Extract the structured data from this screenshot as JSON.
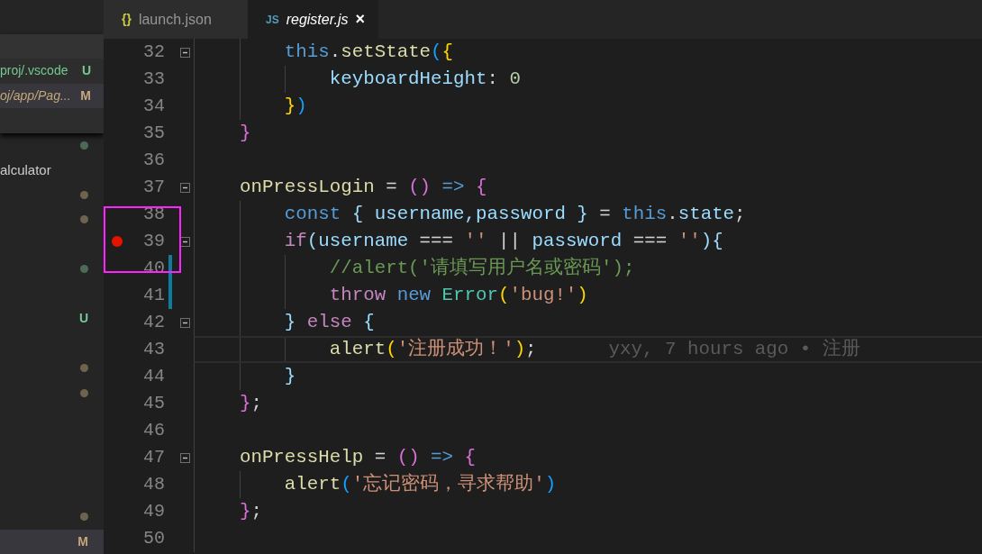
{
  "tabs": [
    {
      "label": "launch.json",
      "icon": "{}",
      "kind": "json",
      "selected": false
    },
    {
      "label": "register.js",
      "icon": "JS",
      "kind": "js",
      "selected": true,
      "close": "×"
    }
  ],
  "open_editors": [
    {
      "kind": "header"
    },
    {
      "kind": "file",
      "label": "proj/.vscode",
      "badge": "U",
      "color": "#73c991",
      "selected": false
    },
    {
      "kind": "file",
      "label": "oj/app/Pag...",
      "badge": "M",
      "color": "#c5a77a",
      "selected": true
    },
    {
      "kind": "blank"
    }
  ],
  "explorer": [
    {
      "kind": "dot",
      "color": "#4b6b55"
    },
    {
      "kind": "folder",
      "label": "alculator"
    },
    {
      "kind": "dot",
      "color": "#6f6350"
    },
    {
      "kind": "dot",
      "color": "#6f6350"
    },
    {
      "kind": "blank"
    },
    {
      "kind": "dot",
      "color": "#4b6b55"
    },
    {
      "kind": "blank"
    },
    {
      "kind": "badge",
      "badge": "U",
      "color": "#73c991",
      "selected": false
    },
    {
      "kind": "blank"
    },
    {
      "kind": "dot",
      "color": "#6f6350"
    },
    {
      "kind": "dot",
      "color": "#6f6350"
    },
    {
      "kind": "blank"
    },
    {
      "kind": "blank"
    },
    {
      "kind": "blank"
    },
    {
      "kind": "blank"
    },
    {
      "kind": "dot",
      "color": "#6f6350"
    },
    {
      "kind": "badge",
      "badge": "M",
      "color": "#c5a77a",
      "selected": true
    }
  ],
  "lines": [
    {
      "number": "32",
      "fold": true,
      "breakpoint": false,
      "changed": false,
      "tokens": [
        {
          "text": "        this",
          "kind": "keyword"
        },
        {
          "text": ".",
          "kind": "plain"
        },
        {
          "text": "setState",
          "kind": "function"
        },
        {
          "text": "(",
          "kind": "bracket",
          "color": "#179fff"
        },
        {
          "text": "{",
          "kind": "bracket",
          "color": "#ffd700"
        }
      ]
    },
    {
      "number": "33",
      "fold": false,
      "breakpoint": false,
      "changed": false,
      "tokens": [
        {
          "text": "            keyboardHeight",
          "kind": "property"
        },
        {
          "text": ": ",
          "kind": "plain"
        },
        {
          "text": "0",
          "kind": "number"
        }
      ]
    },
    {
      "number": "34",
      "fold": false,
      "breakpoint": false,
      "changed": false,
      "tokens": [
        {
          "text": "        }",
          "kind": "bracket",
          "color": "#ffd700"
        },
        {
          "text": ")",
          "kind": "bracket",
          "color": "#179fff"
        }
      ]
    },
    {
      "number": "35",
      "fold": false,
      "breakpoint": false,
      "changed": false,
      "tokens": [
        {
          "text": "    }",
          "kind": "bracket",
          "color": "#da70d6"
        }
      ]
    },
    {
      "number": "36",
      "fold": false,
      "breakpoint": false,
      "changed": false
    },
    {
      "number": "37",
      "fold": true,
      "breakpoint": false,
      "changed": false,
      "tokens": [
        {
          "text": "    onPressLogin",
          "kind": "function"
        },
        {
          "text": " = ",
          "kind": "plain"
        },
        {
          "text": "()",
          "kind": "bracket",
          "color": "#da70d6"
        },
        {
          "text": " => ",
          "kind": "keyword"
        },
        {
          "text": "{",
          "kind": "bracket",
          "color": "#da70d6"
        }
      ]
    },
    {
      "number": "38",
      "fold": false,
      "breakpoint": false,
      "changed": false,
      "tokens": [
        {
          "text": "        const ",
          "kind": "keyword"
        },
        {
          "text": "{",
          "kind": "bracket",
          "color": "#9cdcfe"
        },
        {
          "text": " username,password ",
          "kind": "property"
        },
        {
          "text": "}",
          "kind": "bracket",
          "color": "#9cdcfe"
        },
        {
          "text": " = ",
          "kind": "plain"
        },
        {
          "text": "this",
          "kind": "keyword"
        },
        {
          "text": ".",
          "kind": "plain"
        },
        {
          "text": "state",
          "kind": "property"
        },
        {
          "text": ";",
          "kind": "plain"
        }
      ]
    },
    {
      "number": "39",
      "fold": true,
      "breakpoint": true,
      "changed": false,
      "tokens": [
        {
          "text": "        if",
          "kind": "control"
        },
        {
          "text": "(",
          "kind": "bracket",
          "color": "#9cdcfe"
        },
        {
          "text": "username",
          "kind": "property"
        },
        {
          "text": " === ",
          "kind": "plain"
        },
        {
          "text": "''",
          "kind": "string"
        },
        {
          "text": " || ",
          "kind": "plain"
        },
        {
          "text": "password",
          "kind": "property"
        },
        {
          "text": " === ",
          "kind": "plain"
        },
        {
          "text": "''",
          "kind": "string"
        },
        {
          "text": "){",
          "kind": "bracket",
          "color": "#9cdcfe"
        }
      ]
    },
    {
      "number": "40",
      "fold": false,
      "breakpoint": false,
      "changed": true,
      "tokens": [
        {
          "text": "            //alert('请填写用户名或密码');",
          "kind": "comment"
        }
      ]
    },
    {
      "number": "41",
      "fold": false,
      "breakpoint": false,
      "changed": true,
      "tokens": [
        {
          "text": "            throw ",
          "kind": "control"
        },
        {
          "text": "new ",
          "kind": "keyword"
        },
        {
          "text": "Error",
          "kind": "class"
        },
        {
          "text": "(",
          "kind": "bracket",
          "color": "#ffd700"
        },
        {
          "text": "'bug!'",
          "kind": "string"
        },
        {
          "text": ")",
          "kind": "bracket",
          "color": "#ffd700"
        }
      ]
    },
    {
      "number": "42",
      "fold": true,
      "breakpoint": false,
      "changed": false,
      "tokens": [
        {
          "text": "        }",
          "kind": "bracket",
          "color": "#9cdcfe"
        },
        {
          "text": " else ",
          "kind": "control"
        },
        {
          "text": "{",
          "kind": "bracket",
          "color": "#9cdcfe"
        }
      ]
    },
    {
      "number": "43",
      "fold": false,
      "breakpoint": false,
      "changed": false,
      "current": true,
      "tokens": [
        {
          "text": "            alert",
          "kind": "function"
        },
        {
          "text": "(",
          "kind": "bracket",
          "color": "#ffd700"
        },
        {
          "text": "'注册成功！'",
          "kind": "string"
        },
        {
          "text": ")",
          "kind": "bracket",
          "color": "#ffd700"
        },
        {
          "text": ";",
          "kind": "plain"
        }
      ],
      "blame": "yxy, 7 hours ago • 注册"
    },
    {
      "number": "44",
      "fold": false,
      "breakpoint": false,
      "changed": false,
      "tokens": [
        {
          "text": "        }",
          "kind": "bracket",
          "color": "#9cdcfe"
        }
      ]
    },
    {
      "number": "45",
      "fold": false,
      "breakpoint": false,
      "changed": false,
      "tokens": [
        {
          "text": "    }",
          "kind": "bracket",
          "color": "#da70d6"
        },
        {
          "text": ";",
          "kind": "plain"
        }
      ]
    },
    {
      "number": "46",
      "fold": false,
      "breakpoint": false,
      "changed": false
    },
    {
      "number": "47",
      "fold": true,
      "breakpoint": false,
      "changed": false,
      "tokens": [
        {
          "text": "    onPressHelp",
          "kind": "function"
        },
        {
          "text": " = ",
          "kind": "plain"
        },
        {
          "text": "()",
          "kind": "bracket",
          "color": "#da70d6"
        },
        {
          "text": " => ",
          "kind": "keyword"
        },
        {
          "text": "{",
          "kind": "bracket",
          "color": "#da70d6"
        }
      ]
    },
    {
      "number": "48",
      "fold": false,
      "breakpoint": false,
      "changed": false,
      "tokens": [
        {
          "text": "        alert",
          "kind": "function"
        },
        {
          "text": "(",
          "kind": "bracket",
          "color": "#179fff"
        },
        {
          "text": "'忘记密码，寻求帮助'",
          "kind": "string"
        },
        {
          "text": ")",
          "kind": "bracket",
          "color": "#179fff"
        }
      ]
    },
    {
      "number": "49",
      "fold": false,
      "breakpoint": false,
      "changed": false,
      "tokens": [
        {
          "text": "    }",
          "kind": "bracket",
          "color": "#da70d6"
        },
        {
          "text": ";",
          "kind": "plain"
        }
      ]
    },
    {
      "number": "50",
      "fold": false,
      "breakpoint": false,
      "changed": false
    }
  ]
}
